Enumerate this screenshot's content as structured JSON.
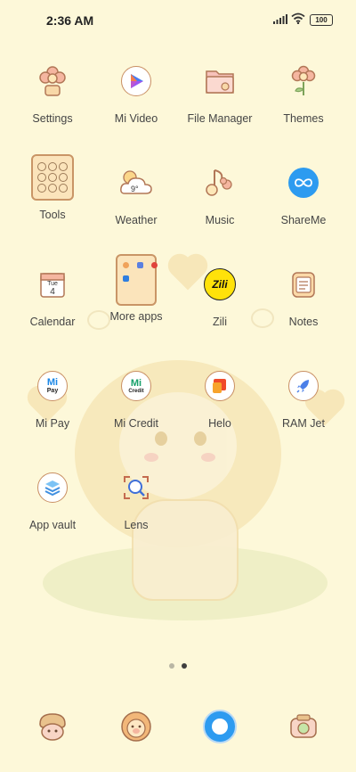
{
  "status_bar": {
    "time": "2:36 AM",
    "battery": "100"
  },
  "apps": [
    {
      "label": "Settings"
    },
    {
      "label": "Mi Video"
    },
    {
      "label": "File Manager"
    },
    {
      "label": "Themes"
    },
    {
      "label": "Tools"
    },
    {
      "label": "Weather",
      "temperature": "9°"
    },
    {
      "label": "Music"
    },
    {
      "label": "ShareMe"
    },
    {
      "label": "Calendar",
      "day": "Tue",
      "date": "4"
    },
    {
      "label": "More apps"
    },
    {
      "label": "Zili",
      "badge": "Zili"
    },
    {
      "label": "Notes"
    },
    {
      "label": "Mi Pay",
      "badge_top": "Mi",
      "badge_bottom": "Pay"
    },
    {
      "label": "Mi Credit",
      "badge_top": "Mi",
      "badge_bottom": "Credit"
    },
    {
      "label": "Helo"
    },
    {
      "label": "RAM Jet"
    },
    {
      "label": "App vault"
    },
    {
      "label": "Lens"
    }
  ],
  "page_indicator": {
    "pages": 2,
    "current": 2
  },
  "colors": {
    "background": "#fdf8d9",
    "icon_outline": "#c98f63",
    "accent_blue": "#2d9bf0"
  }
}
